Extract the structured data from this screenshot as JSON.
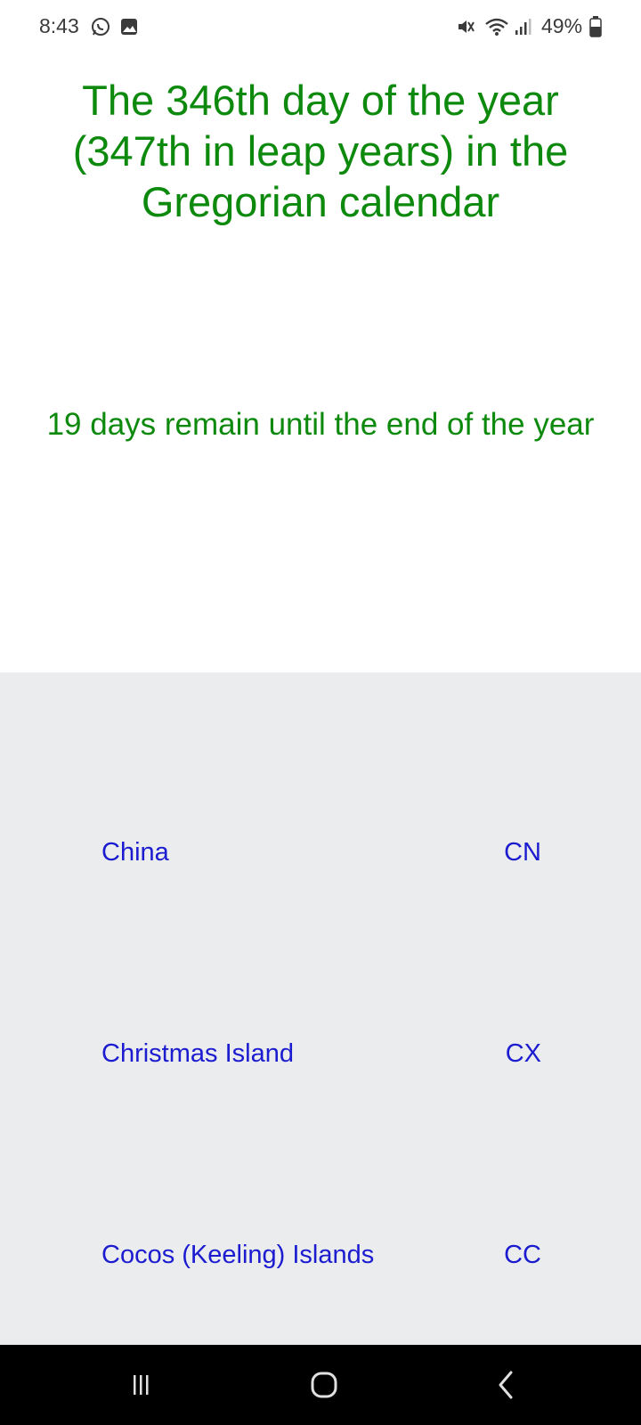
{
  "status_bar": {
    "time": "8:43",
    "battery": "49%",
    "icons": [
      "whatsapp-icon",
      "gallery-icon",
      "mute-icon",
      "wifi-icon",
      "signal-icon",
      "battery-icon"
    ]
  },
  "main": {
    "headline": "The 346th day of the year (347th in leap years) in the Gregorian calendar",
    "subline": "19 days remain until the end of the year"
  },
  "countries": [
    {
      "name": "China",
      "code": "CN"
    },
    {
      "name": "Christmas Island",
      "code": "CX"
    },
    {
      "name": "Cocos (Keeling) Islands",
      "code": "CC"
    }
  ],
  "nav_bar": {
    "icons": [
      "recent-apps-icon",
      "home-icon",
      "back-icon"
    ]
  },
  "colors": {
    "headline": "#0d8a0d",
    "link": "#1b1bd0",
    "panel_background": "#ebeced",
    "nav_background": "#000000"
  }
}
